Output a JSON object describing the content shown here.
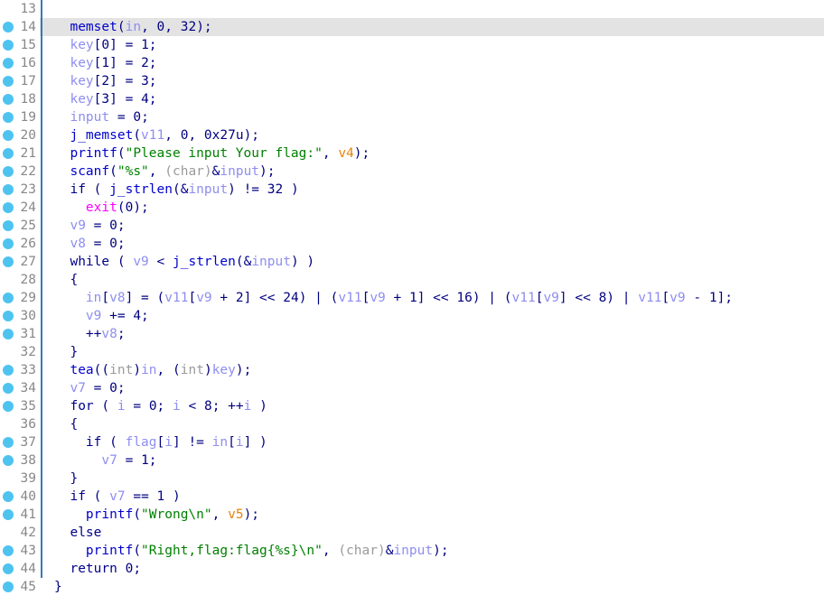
{
  "view": {
    "name": "Pseudocode decompiler view",
    "background": "#ffffff",
    "current_line_highlight": "#e3e3e3",
    "gutter_rule_color": "#3c78b4",
    "breakpoint_color": "#4ec3f0",
    "line_number_color": "#888888"
  },
  "palette": {
    "keyword": "#00008b",
    "function": "#0000cd",
    "variable": "#8e8ef0",
    "string": "#008000",
    "number": "#000080",
    "cast": "#9a9a9a",
    "exit_call": "#ff00ff",
    "argument": "#e8820c"
  },
  "lines": [
    {
      "number": "13",
      "breakpoint": false,
      "current": false,
      "rule": true,
      "tokens": []
    },
    {
      "number": "14",
      "breakpoint": true,
      "current": true,
      "rule": true,
      "tokens": [
        {
          "t": "  ",
          "c": "t-punct"
        },
        {
          "t": "memset",
          "c": "t-fn"
        },
        {
          "t": "(",
          "c": "t-punct"
        },
        {
          "t": "in",
          "c": "t-var"
        },
        {
          "t": ", ",
          "c": "t-punct"
        },
        {
          "t": "0",
          "c": "t-num"
        },
        {
          "t": ", ",
          "c": "t-punct"
        },
        {
          "t": "32",
          "c": "t-num"
        },
        {
          "t": ");",
          "c": "t-punct"
        }
      ]
    },
    {
      "number": "15",
      "breakpoint": true,
      "current": false,
      "rule": true,
      "tokens": [
        {
          "t": "  ",
          "c": "t-punct"
        },
        {
          "t": "key",
          "c": "t-var"
        },
        {
          "t": "[",
          "c": "t-punct"
        },
        {
          "t": "0",
          "c": "t-num"
        },
        {
          "t": "] = ",
          "c": "t-punct"
        },
        {
          "t": "1",
          "c": "t-num"
        },
        {
          "t": ";",
          "c": "t-punct"
        }
      ]
    },
    {
      "number": "16",
      "breakpoint": true,
      "current": false,
      "rule": true,
      "tokens": [
        {
          "t": "  ",
          "c": "t-punct"
        },
        {
          "t": "key",
          "c": "t-var"
        },
        {
          "t": "[",
          "c": "t-punct"
        },
        {
          "t": "1",
          "c": "t-num"
        },
        {
          "t": "] = ",
          "c": "t-punct"
        },
        {
          "t": "2",
          "c": "t-num"
        },
        {
          "t": ";",
          "c": "t-punct"
        }
      ]
    },
    {
      "number": "17",
      "breakpoint": true,
      "current": false,
      "rule": true,
      "tokens": [
        {
          "t": "  ",
          "c": "t-punct"
        },
        {
          "t": "key",
          "c": "t-var"
        },
        {
          "t": "[",
          "c": "t-punct"
        },
        {
          "t": "2",
          "c": "t-num"
        },
        {
          "t": "] = ",
          "c": "t-punct"
        },
        {
          "t": "3",
          "c": "t-num"
        },
        {
          "t": ";",
          "c": "t-punct"
        }
      ]
    },
    {
      "number": "18",
      "breakpoint": true,
      "current": false,
      "rule": true,
      "tokens": [
        {
          "t": "  ",
          "c": "t-punct"
        },
        {
          "t": "key",
          "c": "t-var"
        },
        {
          "t": "[",
          "c": "t-punct"
        },
        {
          "t": "3",
          "c": "t-num"
        },
        {
          "t": "] = ",
          "c": "t-punct"
        },
        {
          "t": "4",
          "c": "t-num"
        },
        {
          "t": ";",
          "c": "t-punct"
        }
      ]
    },
    {
      "number": "19",
      "breakpoint": true,
      "current": false,
      "rule": true,
      "tokens": [
        {
          "t": "  ",
          "c": "t-punct"
        },
        {
          "t": "input",
          "c": "t-var"
        },
        {
          "t": " = ",
          "c": "t-punct"
        },
        {
          "t": "0",
          "c": "t-num"
        },
        {
          "t": ";",
          "c": "t-punct"
        }
      ]
    },
    {
      "number": "20",
      "breakpoint": true,
      "current": false,
      "rule": true,
      "tokens": [
        {
          "t": "  ",
          "c": "t-punct"
        },
        {
          "t": "j_memset",
          "c": "t-fn"
        },
        {
          "t": "(",
          "c": "t-punct"
        },
        {
          "t": "v11",
          "c": "t-var"
        },
        {
          "t": ", ",
          "c": "t-punct"
        },
        {
          "t": "0",
          "c": "t-num"
        },
        {
          "t": ", ",
          "c": "t-punct"
        },
        {
          "t": "0x27u",
          "c": "t-num"
        },
        {
          "t": ");",
          "c": "t-punct"
        }
      ]
    },
    {
      "number": "21",
      "breakpoint": true,
      "current": false,
      "rule": true,
      "tokens": [
        {
          "t": "  ",
          "c": "t-punct"
        },
        {
          "t": "printf",
          "c": "t-fn"
        },
        {
          "t": "(",
          "c": "t-punct"
        },
        {
          "t": "\"Please input Your flag:\"",
          "c": "t-str"
        },
        {
          "t": ", ",
          "c": "t-punct"
        },
        {
          "t": "v4",
          "c": "t-arg"
        },
        {
          "t": ");",
          "c": "t-punct"
        }
      ]
    },
    {
      "number": "22",
      "breakpoint": true,
      "current": false,
      "rule": true,
      "tokens": [
        {
          "t": "  ",
          "c": "t-punct"
        },
        {
          "t": "scanf",
          "c": "t-fn"
        },
        {
          "t": "(",
          "c": "t-punct"
        },
        {
          "t": "\"%s\"",
          "c": "t-str"
        },
        {
          "t": ", ",
          "c": "t-punct"
        },
        {
          "t": "(char)",
          "c": "t-cast"
        },
        {
          "t": "&",
          "c": "t-amp"
        },
        {
          "t": "input",
          "c": "t-var"
        },
        {
          "t": ");",
          "c": "t-punct"
        }
      ]
    },
    {
      "number": "23",
      "breakpoint": true,
      "current": false,
      "rule": true,
      "tokens": [
        {
          "t": "  ",
          "c": "t-punct"
        },
        {
          "t": "if",
          "c": "t-kw"
        },
        {
          "t": " ( ",
          "c": "t-punct"
        },
        {
          "t": "j_strlen",
          "c": "t-fn"
        },
        {
          "t": "(",
          "c": "t-punct"
        },
        {
          "t": "&",
          "c": "t-amp"
        },
        {
          "t": "input",
          "c": "t-var"
        },
        {
          "t": ") != ",
          "c": "t-punct"
        },
        {
          "t": "32",
          "c": "t-num"
        },
        {
          "t": " )",
          "c": "t-punct"
        }
      ]
    },
    {
      "number": "24",
      "breakpoint": true,
      "current": false,
      "rule": true,
      "tokens": [
        {
          "t": "    ",
          "c": "t-punct"
        },
        {
          "t": "exit",
          "c": "t-exit"
        },
        {
          "t": "(",
          "c": "t-punct"
        },
        {
          "t": "0",
          "c": "t-num"
        },
        {
          "t": ");",
          "c": "t-punct"
        }
      ]
    },
    {
      "number": "25",
      "breakpoint": true,
      "current": false,
      "rule": true,
      "tokens": [
        {
          "t": "  ",
          "c": "t-punct"
        },
        {
          "t": "v9",
          "c": "t-var"
        },
        {
          "t": " = ",
          "c": "t-punct"
        },
        {
          "t": "0",
          "c": "t-num"
        },
        {
          "t": ";",
          "c": "t-punct"
        }
      ]
    },
    {
      "number": "26",
      "breakpoint": true,
      "current": false,
      "rule": true,
      "tokens": [
        {
          "t": "  ",
          "c": "t-punct"
        },
        {
          "t": "v8",
          "c": "t-var"
        },
        {
          "t": " = ",
          "c": "t-punct"
        },
        {
          "t": "0",
          "c": "t-num"
        },
        {
          "t": ";",
          "c": "t-punct"
        }
      ]
    },
    {
      "number": "27",
      "breakpoint": true,
      "current": false,
      "rule": true,
      "tokens": [
        {
          "t": "  ",
          "c": "t-punct"
        },
        {
          "t": "while",
          "c": "t-kw"
        },
        {
          "t": " ( ",
          "c": "t-punct"
        },
        {
          "t": "v9",
          "c": "t-var"
        },
        {
          "t": " < ",
          "c": "t-punct"
        },
        {
          "t": "j_strlen",
          "c": "t-fn"
        },
        {
          "t": "(",
          "c": "t-punct"
        },
        {
          "t": "&",
          "c": "t-amp"
        },
        {
          "t": "input",
          "c": "t-var"
        },
        {
          "t": ") )",
          "c": "t-punct"
        }
      ]
    },
    {
      "number": "28",
      "breakpoint": false,
      "current": false,
      "rule": true,
      "tokens": [
        {
          "t": "  {",
          "c": "t-punct"
        }
      ]
    },
    {
      "number": "29",
      "breakpoint": true,
      "current": false,
      "rule": true,
      "tokens": [
        {
          "t": "    ",
          "c": "t-punct"
        },
        {
          "t": "in",
          "c": "t-var"
        },
        {
          "t": "[",
          "c": "t-punct"
        },
        {
          "t": "v8",
          "c": "t-var"
        },
        {
          "t": "] = (",
          "c": "t-punct"
        },
        {
          "t": "v11",
          "c": "t-var"
        },
        {
          "t": "[",
          "c": "t-punct"
        },
        {
          "t": "v9",
          "c": "t-var"
        },
        {
          "t": " + ",
          "c": "t-punct"
        },
        {
          "t": "2",
          "c": "t-num"
        },
        {
          "t": "] << ",
          "c": "t-punct"
        },
        {
          "t": "24",
          "c": "t-num"
        },
        {
          "t": ") | (",
          "c": "t-punct"
        },
        {
          "t": "v11",
          "c": "t-var"
        },
        {
          "t": "[",
          "c": "t-punct"
        },
        {
          "t": "v9",
          "c": "t-var"
        },
        {
          "t": " + ",
          "c": "t-punct"
        },
        {
          "t": "1",
          "c": "t-num"
        },
        {
          "t": "] << ",
          "c": "t-punct"
        },
        {
          "t": "16",
          "c": "t-num"
        },
        {
          "t": ") | (",
          "c": "t-punct"
        },
        {
          "t": "v11",
          "c": "t-var"
        },
        {
          "t": "[",
          "c": "t-punct"
        },
        {
          "t": "v9",
          "c": "t-var"
        },
        {
          "t": "] << ",
          "c": "t-punct"
        },
        {
          "t": "8",
          "c": "t-num"
        },
        {
          "t": ") | ",
          "c": "t-punct"
        },
        {
          "t": "v11",
          "c": "t-var"
        },
        {
          "t": "[",
          "c": "t-punct"
        },
        {
          "t": "v9",
          "c": "t-var"
        },
        {
          "t": " - ",
          "c": "t-punct"
        },
        {
          "t": "1",
          "c": "t-num"
        },
        {
          "t": "];",
          "c": "t-punct"
        }
      ]
    },
    {
      "number": "30",
      "breakpoint": true,
      "current": false,
      "rule": true,
      "tokens": [
        {
          "t": "    ",
          "c": "t-punct"
        },
        {
          "t": "v9",
          "c": "t-var"
        },
        {
          "t": " += ",
          "c": "t-punct"
        },
        {
          "t": "4",
          "c": "t-num"
        },
        {
          "t": ";",
          "c": "t-punct"
        }
      ]
    },
    {
      "number": "31",
      "breakpoint": true,
      "current": false,
      "rule": true,
      "tokens": [
        {
          "t": "    ++",
          "c": "t-punct"
        },
        {
          "t": "v8",
          "c": "t-var"
        },
        {
          "t": ";",
          "c": "t-punct"
        }
      ]
    },
    {
      "number": "32",
      "breakpoint": false,
      "current": false,
      "rule": true,
      "tokens": [
        {
          "t": "  }",
          "c": "t-punct"
        }
      ]
    },
    {
      "number": "33",
      "breakpoint": true,
      "current": false,
      "rule": true,
      "tokens": [
        {
          "t": "  ",
          "c": "t-punct"
        },
        {
          "t": "tea",
          "c": "t-fn"
        },
        {
          "t": "((",
          "c": "t-punct"
        },
        {
          "t": "int",
          "c": "t-cast"
        },
        {
          "t": ")",
          "c": "t-punct"
        },
        {
          "t": "in",
          "c": "t-var"
        },
        {
          "t": ", (",
          "c": "t-punct"
        },
        {
          "t": "int",
          "c": "t-cast"
        },
        {
          "t": ")",
          "c": "t-punct"
        },
        {
          "t": "key",
          "c": "t-var"
        },
        {
          "t": ");",
          "c": "t-punct"
        }
      ]
    },
    {
      "number": "34",
      "breakpoint": true,
      "current": false,
      "rule": true,
      "tokens": [
        {
          "t": "  ",
          "c": "t-punct"
        },
        {
          "t": "v7",
          "c": "t-var"
        },
        {
          "t": " = ",
          "c": "t-punct"
        },
        {
          "t": "0",
          "c": "t-num"
        },
        {
          "t": ";",
          "c": "t-punct"
        }
      ]
    },
    {
      "number": "35",
      "breakpoint": true,
      "current": false,
      "rule": true,
      "tokens": [
        {
          "t": "  ",
          "c": "t-punct"
        },
        {
          "t": "for",
          "c": "t-kw"
        },
        {
          "t": " ( ",
          "c": "t-punct"
        },
        {
          "t": "i",
          "c": "t-var"
        },
        {
          "t": " = ",
          "c": "t-punct"
        },
        {
          "t": "0",
          "c": "t-num"
        },
        {
          "t": "; ",
          "c": "t-punct"
        },
        {
          "t": "i",
          "c": "t-var"
        },
        {
          "t": " < ",
          "c": "t-punct"
        },
        {
          "t": "8",
          "c": "t-num"
        },
        {
          "t": "; ++",
          "c": "t-punct"
        },
        {
          "t": "i",
          "c": "t-var"
        },
        {
          "t": " )",
          "c": "t-punct"
        }
      ]
    },
    {
      "number": "36",
      "breakpoint": false,
      "current": false,
      "rule": true,
      "tokens": [
        {
          "t": "  {",
          "c": "t-punct"
        }
      ]
    },
    {
      "number": "37",
      "breakpoint": true,
      "current": false,
      "rule": true,
      "tokens": [
        {
          "t": "    ",
          "c": "t-punct"
        },
        {
          "t": "if",
          "c": "t-kw"
        },
        {
          "t": " ( ",
          "c": "t-punct"
        },
        {
          "t": "flag",
          "c": "t-var"
        },
        {
          "t": "[",
          "c": "t-punct"
        },
        {
          "t": "i",
          "c": "t-var"
        },
        {
          "t": "] != ",
          "c": "t-punct"
        },
        {
          "t": "in",
          "c": "t-var"
        },
        {
          "t": "[",
          "c": "t-punct"
        },
        {
          "t": "i",
          "c": "t-var"
        },
        {
          "t": "] )",
          "c": "t-punct"
        }
      ]
    },
    {
      "number": "38",
      "breakpoint": true,
      "current": false,
      "rule": true,
      "tokens": [
        {
          "t": "      ",
          "c": "t-punct"
        },
        {
          "t": "v7",
          "c": "t-var"
        },
        {
          "t": " = ",
          "c": "t-punct"
        },
        {
          "t": "1",
          "c": "t-num"
        },
        {
          "t": ";",
          "c": "t-punct"
        }
      ]
    },
    {
      "number": "39",
      "breakpoint": false,
      "current": false,
      "rule": true,
      "tokens": [
        {
          "t": "  }",
          "c": "t-punct"
        }
      ]
    },
    {
      "number": "40",
      "breakpoint": true,
      "current": false,
      "rule": true,
      "tokens": [
        {
          "t": "  ",
          "c": "t-punct"
        },
        {
          "t": "if",
          "c": "t-kw"
        },
        {
          "t": " ( ",
          "c": "t-punct"
        },
        {
          "t": "v7",
          "c": "t-var"
        },
        {
          "t": " == ",
          "c": "t-punct"
        },
        {
          "t": "1",
          "c": "t-num"
        },
        {
          "t": " )",
          "c": "t-punct"
        }
      ]
    },
    {
      "number": "41",
      "breakpoint": true,
      "current": false,
      "rule": true,
      "tokens": [
        {
          "t": "    ",
          "c": "t-punct"
        },
        {
          "t": "printf",
          "c": "t-fn"
        },
        {
          "t": "(",
          "c": "t-punct"
        },
        {
          "t": "\"Wrong\\n\"",
          "c": "t-str"
        },
        {
          "t": ", ",
          "c": "t-punct"
        },
        {
          "t": "v5",
          "c": "t-arg"
        },
        {
          "t": ");",
          "c": "t-punct"
        }
      ]
    },
    {
      "number": "42",
      "breakpoint": false,
      "current": false,
      "rule": true,
      "tokens": [
        {
          "t": "  ",
          "c": "t-punct"
        },
        {
          "t": "else",
          "c": "t-kw"
        }
      ]
    },
    {
      "number": "43",
      "breakpoint": true,
      "current": false,
      "rule": true,
      "tokens": [
        {
          "t": "    ",
          "c": "t-punct"
        },
        {
          "t": "printf",
          "c": "t-fn"
        },
        {
          "t": "(",
          "c": "t-punct"
        },
        {
          "t": "\"Right,flag:flag{%s}\\n\"",
          "c": "t-str"
        },
        {
          "t": ", ",
          "c": "t-punct"
        },
        {
          "t": "(char)",
          "c": "t-cast"
        },
        {
          "t": "&",
          "c": "t-amp"
        },
        {
          "t": "input",
          "c": "t-var"
        },
        {
          "t": ");",
          "c": "t-punct"
        }
      ]
    },
    {
      "number": "44",
      "breakpoint": true,
      "current": false,
      "rule": true,
      "tokens": [
        {
          "t": "  ",
          "c": "t-punct"
        },
        {
          "t": "return",
          "c": "t-kw"
        },
        {
          "t": " ",
          "c": "t-punct"
        },
        {
          "t": "0",
          "c": "t-num"
        },
        {
          "t": ";",
          "c": "t-punct"
        }
      ]
    },
    {
      "number": "45",
      "breakpoint": true,
      "current": false,
      "rule": false,
      "tokens": [
        {
          "t": "}",
          "c": "t-punct"
        }
      ]
    },
    {
      "number": "",
      "breakpoint": false,
      "current": false,
      "rule": false,
      "tokens": []
    }
  ]
}
